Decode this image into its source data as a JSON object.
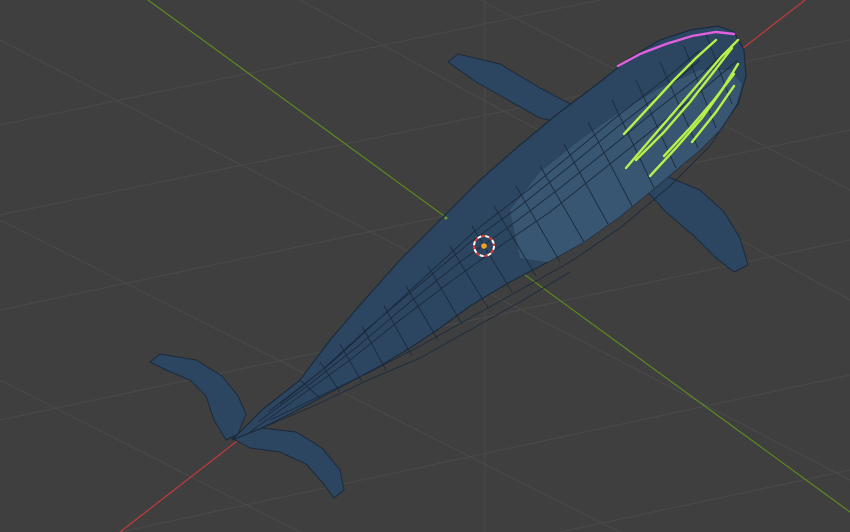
{
  "viewport": {
    "background_color": "#3f3f3f",
    "grid_color": "#4a4a4a",
    "x_axis_color": "#c23b3b",
    "y_axis_color": "#5d8a1e"
  },
  "model": {
    "body_color": "#2c4560",
    "belly_color": "#3a5674",
    "wire_color": "#1b2b3d",
    "selected_edge_color": "#b8f04a",
    "active_edge_color": "#e060e0"
  },
  "cursor": {
    "icon": "3d-cursor-icon",
    "ring_color_a": "#ffffff",
    "ring_color_b": "#e03c3c"
  },
  "origin": {
    "icon": "object-origin-icon",
    "color": "#f0a020"
  }
}
